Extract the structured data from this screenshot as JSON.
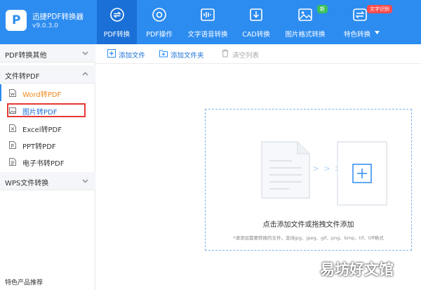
{
  "app": {
    "title": "迅捷PDF转换器",
    "version": "v9.0.3.0",
    "logo_icon": "app-logo-icon",
    "logo_letter": "P"
  },
  "colors": {
    "header_bg": "#2d8cf0",
    "header_active": "#1a70d6",
    "accent_orange": "#f08a1c",
    "highlight_red": "#e53935",
    "badge_green": "#3cc25a",
    "badge_red": "#ff4a4a"
  },
  "nav": {
    "tabs": [
      {
        "label": "PDF转换",
        "icon": "convert-icon",
        "active": true
      },
      {
        "label": "PDF操作",
        "icon": "settings-icon",
        "active": false
      },
      {
        "label": "文字语音转换",
        "icon": "audio-wave-icon",
        "active": false
      },
      {
        "label": "CAD转换",
        "icon": "cad-icon",
        "active": false
      },
      {
        "label": "图片格式转换",
        "icon": "image-icon",
        "active": false,
        "badge": "新"
      },
      {
        "label": "特色转换",
        "icon": "swap-icon",
        "active": false,
        "badge": "文字识别",
        "dropdown": true
      }
    ]
  },
  "sidebar": {
    "sections": [
      {
        "title": "PDF转换其他",
        "expanded": false
      },
      {
        "title": "文件转PDF",
        "expanded": true
      },
      {
        "title": "WPS文件转换",
        "expanded": false
      }
    ],
    "items": [
      {
        "label": "Word转PDF",
        "icon": "word-file-icon",
        "current": true
      },
      {
        "label": "图片转PDF",
        "icon": "image-file-icon",
        "selected": true
      },
      {
        "label": "Excel转PDF",
        "icon": "excel-file-icon"
      },
      {
        "label": "PPT转PDF",
        "icon": "ppt-file-icon"
      },
      {
        "label": "电子书转PDF",
        "icon": "ebook-file-icon"
      }
    ],
    "footer": "特色产品推荐"
  },
  "toolbar": {
    "add_file": "添加文件",
    "add_folder": "添加文件夹",
    "clear_list": "清空列表"
  },
  "dropzone": {
    "title": "点击添加文件或拖拽文件添加",
    "note": "*请添加需要转换的文件，支持jpg、jpeg、gif、png、bmp、tif、tiff格式",
    "arrows": "> > >"
  },
  "watermark": "易坊好文馆"
}
